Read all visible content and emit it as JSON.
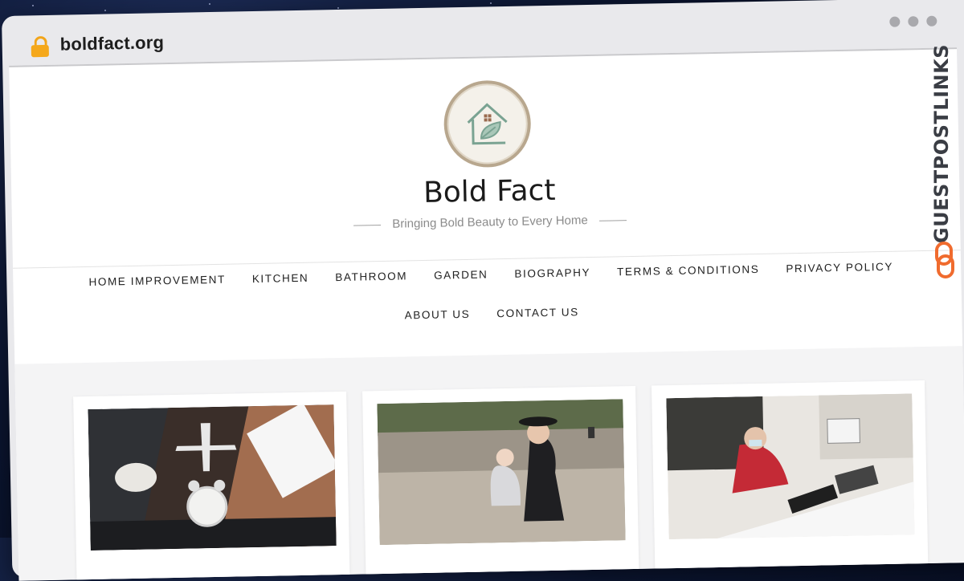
{
  "browser": {
    "url": "boldfact.org"
  },
  "site": {
    "title": "Bold Fact",
    "tagline": "Bringing Bold Beauty to Every Home"
  },
  "nav": {
    "row1": [
      "HOME IMPROVEMENT",
      "KITCHEN",
      "BATHROOM",
      "GARDEN",
      "BIOGRAPHY",
      "TERMS & CONDITIONS",
      "PRIVACY POLICY"
    ],
    "row2": [
      "ABOUT US",
      "CONTACT US"
    ]
  },
  "watermark": {
    "text": "GUESTPOSTLINKS"
  },
  "colors": {
    "accent": "#f06b2e",
    "logo_green": "#7aa392"
  }
}
